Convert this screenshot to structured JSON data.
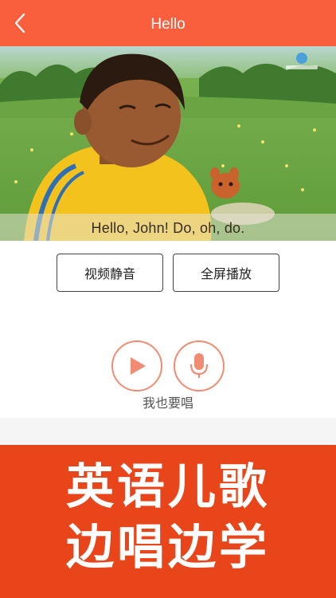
{
  "header": {
    "title": "Hello",
    "back_icon": "chevron-left-icon"
  },
  "video": {
    "subtitle": "Hello, John! Do, oh, do."
  },
  "buttons": {
    "mute_label": "视频静音",
    "fullscreen_label": "全屏播放"
  },
  "controls": {
    "play_icon": "play-icon",
    "mic_icon": "microphone-icon",
    "sing_label": "我也要唱"
  },
  "promo": {
    "line1": "英语儿歌",
    "line2": "边唱边学"
  },
  "colors": {
    "accent": "#fa5f3d",
    "promo_bg": "#e8451a",
    "control_ring": "#f08c73"
  }
}
